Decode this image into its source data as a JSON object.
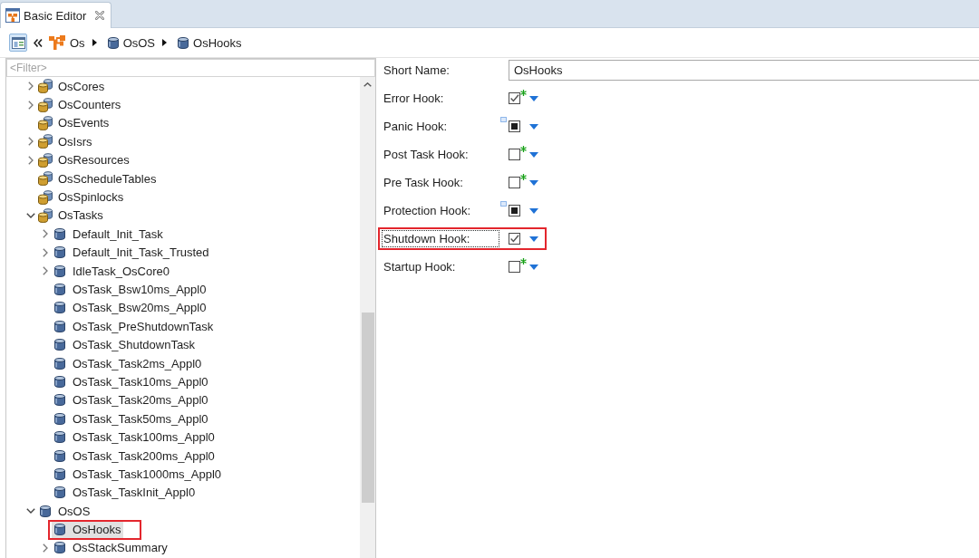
{
  "tabs": [
    {
      "label": "Basic Editor",
      "selected": true
    }
  ],
  "breadcrumb": [
    {
      "label": "Os",
      "kind": "module"
    },
    {
      "label": "OsOS",
      "kind": "instance"
    },
    {
      "label": "OsHooks",
      "kind": "instance"
    }
  ],
  "tree": {
    "filter_placeholder": "<Filter>",
    "items": [
      {
        "label": "OsCores",
        "kind": "container",
        "expandable": true,
        "expanded": false,
        "selected": false,
        "highlighted": false
      },
      {
        "label": "OsCounters",
        "kind": "container",
        "expandable": true,
        "expanded": false,
        "selected": false,
        "highlighted": false
      },
      {
        "label": "OsEvents",
        "kind": "container",
        "expandable": false,
        "expanded": false,
        "selected": false,
        "highlighted": false
      },
      {
        "label": "OsIsrs",
        "kind": "container",
        "expandable": true,
        "expanded": false,
        "selected": false,
        "highlighted": false
      },
      {
        "label": "OsResources",
        "kind": "container",
        "expandable": true,
        "expanded": false,
        "selected": false,
        "highlighted": false
      },
      {
        "label": "OsScheduleTables",
        "kind": "container",
        "expandable": false,
        "expanded": false,
        "selected": false,
        "highlighted": false
      },
      {
        "label": "OsSpinlocks",
        "kind": "container",
        "expandable": false,
        "expanded": false,
        "selected": false,
        "highlighted": false
      },
      {
        "label": "OsTasks",
        "kind": "container",
        "expandable": true,
        "expanded": true,
        "selected": false,
        "highlighted": false,
        "children": [
          {
            "label": "Default_Init_Task",
            "kind": "instance",
            "expandable": true,
            "expanded": false,
            "selected": false,
            "highlighted": false
          },
          {
            "label": "Default_Init_Task_Trusted",
            "kind": "instance",
            "expandable": true,
            "expanded": false,
            "selected": false,
            "highlighted": false
          },
          {
            "label": "IdleTask_OsCore0",
            "kind": "instance",
            "expandable": true,
            "expanded": false,
            "selected": false,
            "highlighted": false
          },
          {
            "label": "OsTask_Bsw10ms_Appl0",
            "kind": "instance",
            "expandable": false,
            "expanded": false,
            "selected": false,
            "highlighted": false
          },
          {
            "label": "OsTask_Bsw20ms_Appl0",
            "kind": "instance",
            "expandable": false,
            "expanded": false,
            "selected": false,
            "highlighted": false
          },
          {
            "label": "OsTask_PreShutdownTask",
            "kind": "instance",
            "expandable": false,
            "expanded": false,
            "selected": false,
            "highlighted": false
          },
          {
            "label": "OsTask_ShutdownTask",
            "kind": "instance",
            "expandable": false,
            "expanded": false,
            "selected": false,
            "highlighted": false
          },
          {
            "label": "OsTask_Task2ms_Appl0",
            "kind": "instance",
            "expandable": false,
            "expanded": false,
            "selected": false,
            "highlighted": false
          },
          {
            "label": "OsTask_Task10ms_Appl0",
            "kind": "instance",
            "expandable": false,
            "expanded": false,
            "selected": false,
            "highlighted": false
          },
          {
            "label": "OsTask_Task20ms_Appl0",
            "kind": "instance",
            "expandable": false,
            "expanded": false,
            "selected": false,
            "highlighted": false
          },
          {
            "label": "OsTask_Task50ms_Appl0",
            "kind": "instance",
            "expandable": false,
            "expanded": false,
            "selected": false,
            "highlighted": false
          },
          {
            "label": "OsTask_Task100ms_Appl0",
            "kind": "instance",
            "expandable": false,
            "expanded": false,
            "selected": false,
            "highlighted": false
          },
          {
            "label": "OsTask_Task200ms_Appl0",
            "kind": "instance",
            "expandable": false,
            "expanded": false,
            "selected": false,
            "highlighted": false
          },
          {
            "label": "OsTask_Task1000ms_Appl0",
            "kind": "instance",
            "expandable": false,
            "expanded": false,
            "selected": false,
            "highlighted": false
          },
          {
            "label": "OsTask_TaskInit_Appl0",
            "kind": "instance",
            "expandable": false,
            "expanded": false,
            "selected": false,
            "highlighted": false
          }
        ]
      },
      {
        "label": "OsOS",
        "kind": "instance",
        "expandable": true,
        "expanded": true,
        "selected": false,
        "highlighted": false,
        "children": [
          {
            "label": "OsHooks",
            "kind": "instance",
            "expandable": false,
            "expanded": false,
            "selected": true,
            "highlighted": true
          },
          {
            "label": "OsStackSummary",
            "kind": "instance",
            "expandable": true,
            "expanded": false,
            "selected": false,
            "highlighted": false
          }
        ]
      }
    ]
  },
  "form": {
    "short_name": {
      "label": "Short Name:",
      "value": "OsHooks"
    },
    "hooks": [
      {
        "label": "Error Hook:",
        "kind": "asterisk",
        "checked": true,
        "indeterminate": false,
        "focused": false,
        "highlighted": false
      },
      {
        "label": "Panic Hook:",
        "kind": "dotted",
        "checked": false,
        "indeterminate": true,
        "focused": false,
        "highlighted": false
      },
      {
        "label": "Post Task Hook:",
        "kind": "asterisk",
        "checked": false,
        "indeterminate": false,
        "focused": false,
        "highlighted": false
      },
      {
        "label": "Pre Task Hook:",
        "kind": "asterisk",
        "checked": false,
        "indeterminate": false,
        "focused": false,
        "highlighted": false
      },
      {
        "label": "Protection Hook:",
        "kind": "dotted",
        "checked": false,
        "indeterminate": true,
        "focused": false,
        "highlighted": false
      },
      {
        "label": "Shutdown Hook:",
        "kind": "plain",
        "checked": true,
        "indeterminate": false,
        "focused": true,
        "highlighted": true
      },
      {
        "label": "Startup Hook:",
        "kind": "asterisk",
        "checked": false,
        "indeterminate": false,
        "focused": false,
        "highlighted": false
      }
    ]
  }
}
